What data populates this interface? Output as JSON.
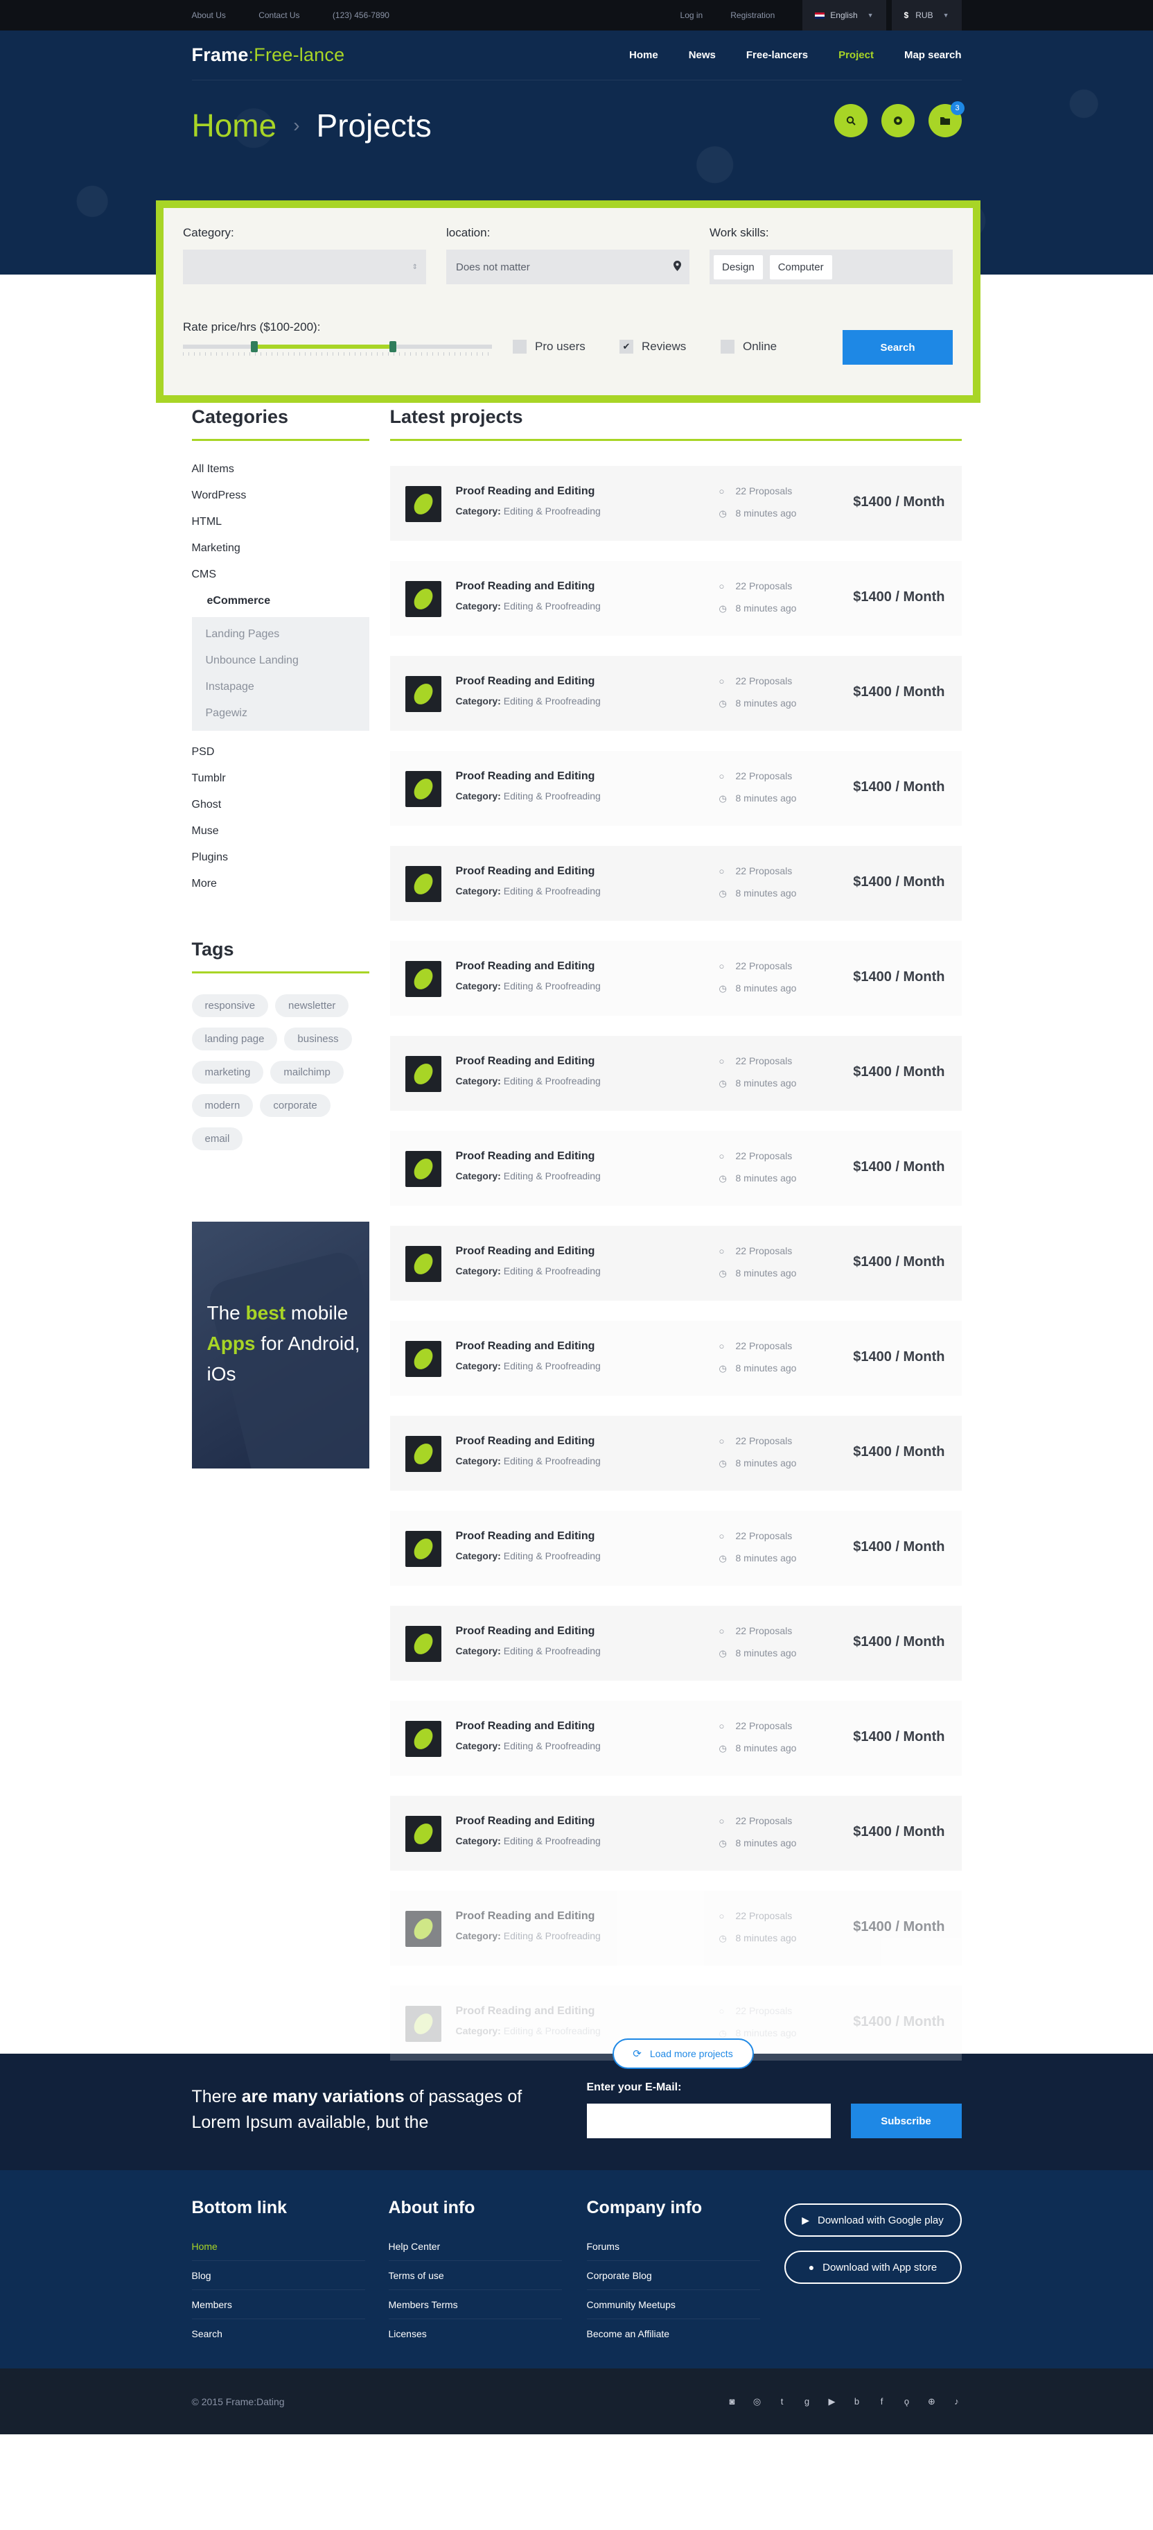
{
  "topbar": {
    "links": [
      "About Us",
      "Contact Us",
      "(123) 456-7890"
    ],
    "login": "Log in",
    "registration": "Registration",
    "language": "English",
    "currency_symbol": "$",
    "currency": "RUB"
  },
  "header": {
    "logo_main": "Frame",
    "logo_sep": ":",
    "logo_accent": "Free-lance",
    "menu": [
      "Home",
      "News",
      "Free-lancers",
      "Project",
      "Map search"
    ],
    "active_menu": "Project",
    "breadcrumb_home": "Home",
    "breadcrumb_sep": "›",
    "breadcrumb_current": "Projects",
    "notification_count": "3"
  },
  "filter": {
    "category_label": "Category:",
    "category_value": "",
    "location_label": "location:",
    "location_value": "Does not matter",
    "skills_label": "Work skills:",
    "skills": [
      "Design",
      "Computer"
    ],
    "rate_label": "Rate price/hrs ($100-200):",
    "rate_range": [
      0.23,
      0.68
    ],
    "checkboxes": [
      {
        "label": "Pro users",
        "checked": false
      },
      {
        "label": "Reviews",
        "checked": true
      },
      {
        "label": "Online",
        "checked": false
      }
    ],
    "search_label": "Search"
  },
  "sidebar": {
    "categories_title": "Categories",
    "categories": [
      "All Items",
      "WordPress",
      "HTML",
      "Marketing",
      "CMS"
    ],
    "active_sub": "eCommerce",
    "sub_items": [
      "Landing Pages",
      "Unbounce Landing",
      "Instapage",
      "Pagewiz"
    ],
    "categories_more": [
      "PSD",
      "Tumblr",
      "Ghost",
      "Muse",
      "Plugins",
      "More"
    ],
    "tags_title": "Tags",
    "tags": [
      "responsive",
      "newsletter",
      "landing page",
      "business",
      "marketing",
      "mailchimp",
      "modern",
      "corporate",
      "email"
    ],
    "promo": {
      "t1": "The ",
      "t2": "best",
      "t3": " mobile",
      "t4": "Apps",
      "t5": " for Android,",
      "t6": "iOs"
    }
  },
  "projects": {
    "title": "Latest projects",
    "item": {
      "title": "Proof Reading and Editing",
      "category_label": "Category:",
      "category": "Editing & Proofreading",
      "proposals": "22 Proposals",
      "posted": "8 minutes ago",
      "price": "$1400 / Month"
    },
    "load_more": "Load more projects"
  },
  "subscribe": {
    "text_a": "There ",
    "text_b": "are many variations",
    "text_c": " of passages of Lorem Ipsum available, but the",
    "email_label": "Enter your E-Mail:",
    "button": "Subscribe"
  },
  "footer": {
    "cols": [
      {
        "title": "Bottom link",
        "links": [
          "Home",
          "Blog",
          "Members",
          "Search"
        ]
      },
      {
        "title": "About info",
        "links": [
          "Help Center",
          "Terms of use",
          "Members Terms",
          "Licenses"
        ]
      },
      {
        "title": "Company info",
        "links": [
          "Forums",
          "Corporate Blog",
          "Community Meetups",
          "Become an Affiliate"
        ]
      }
    ],
    "google_play": "Download with Google play",
    "app_store": "Download with App store",
    "copyright": "© 2015 Frame:Dating",
    "social_icons": [
      "instagram-icon",
      "dribbble-icon",
      "tumblr-icon",
      "google-plus-icon",
      "youtube-icon",
      "blogger-icon",
      "facebook-icon",
      "odnoklassniki-icon",
      "pinterest-icon",
      "lastfm-icon"
    ]
  },
  "colors": {
    "accent": "#a8d526",
    "blue": "#1e88e5",
    "navy": "#0f2a4e"
  }
}
